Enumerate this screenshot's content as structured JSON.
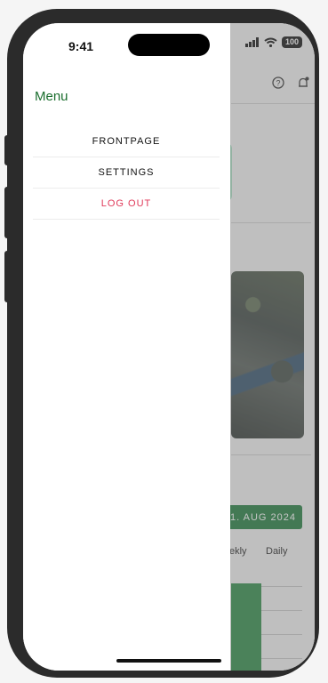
{
  "status_bar": {
    "time": "9:41",
    "battery": "100"
  },
  "drawer": {
    "title": "Menu",
    "items": [
      {
        "label": "FRONTPAGE"
      },
      {
        "label": "SETTINGS"
      },
      {
        "label": "LOG OUT"
      }
    ]
  },
  "background": {
    "date_button": "1. AUG 2024",
    "tabs": [
      {
        "label": "ekly"
      },
      {
        "label": "Daily"
      }
    ]
  },
  "colors": {
    "accent": "#1b6e2e",
    "logout": "#e03a5a",
    "chart_bar": "#2c8a46"
  }
}
